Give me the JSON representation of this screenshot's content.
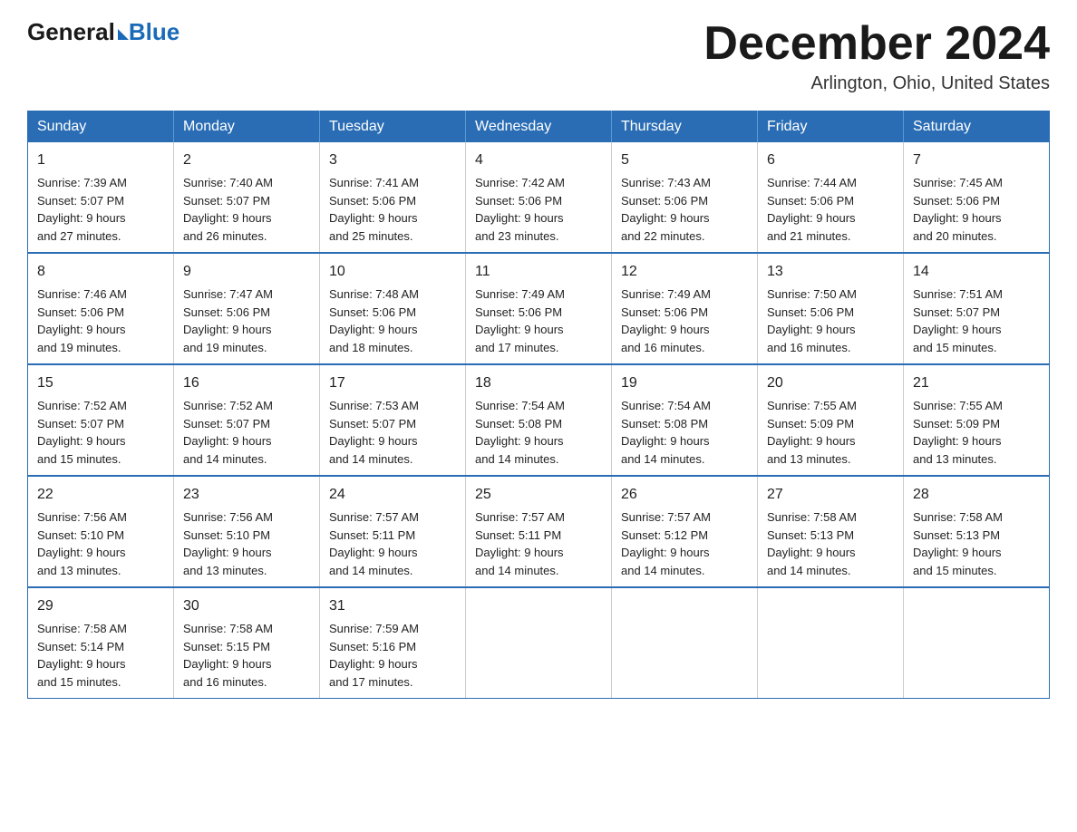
{
  "header": {
    "logo_general": "General",
    "logo_blue": "Blue",
    "month_title": "December 2024",
    "location": "Arlington, Ohio, United States"
  },
  "weekdays": [
    "Sunday",
    "Monday",
    "Tuesday",
    "Wednesday",
    "Thursday",
    "Friday",
    "Saturday"
  ],
  "weeks": [
    [
      {
        "day": "1",
        "sunrise": "7:39 AM",
        "sunset": "5:07 PM",
        "daylight": "9 hours and 27 minutes."
      },
      {
        "day": "2",
        "sunrise": "7:40 AM",
        "sunset": "5:07 PM",
        "daylight": "9 hours and 26 minutes."
      },
      {
        "day": "3",
        "sunrise": "7:41 AM",
        "sunset": "5:06 PM",
        "daylight": "9 hours and 25 minutes."
      },
      {
        "day": "4",
        "sunrise": "7:42 AM",
        "sunset": "5:06 PM",
        "daylight": "9 hours and 23 minutes."
      },
      {
        "day": "5",
        "sunrise": "7:43 AM",
        "sunset": "5:06 PM",
        "daylight": "9 hours and 22 minutes."
      },
      {
        "day": "6",
        "sunrise": "7:44 AM",
        "sunset": "5:06 PM",
        "daylight": "9 hours and 21 minutes."
      },
      {
        "day": "7",
        "sunrise": "7:45 AM",
        "sunset": "5:06 PM",
        "daylight": "9 hours and 20 minutes."
      }
    ],
    [
      {
        "day": "8",
        "sunrise": "7:46 AM",
        "sunset": "5:06 PM",
        "daylight": "9 hours and 19 minutes."
      },
      {
        "day": "9",
        "sunrise": "7:47 AM",
        "sunset": "5:06 PM",
        "daylight": "9 hours and 19 minutes."
      },
      {
        "day": "10",
        "sunrise": "7:48 AM",
        "sunset": "5:06 PM",
        "daylight": "9 hours and 18 minutes."
      },
      {
        "day": "11",
        "sunrise": "7:49 AM",
        "sunset": "5:06 PM",
        "daylight": "9 hours and 17 minutes."
      },
      {
        "day": "12",
        "sunrise": "7:49 AM",
        "sunset": "5:06 PM",
        "daylight": "9 hours and 16 minutes."
      },
      {
        "day": "13",
        "sunrise": "7:50 AM",
        "sunset": "5:06 PM",
        "daylight": "9 hours and 16 minutes."
      },
      {
        "day": "14",
        "sunrise": "7:51 AM",
        "sunset": "5:07 PM",
        "daylight": "9 hours and 15 minutes."
      }
    ],
    [
      {
        "day": "15",
        "sunrise": "7:52 AM",
        "sunset": "5:07 PM",
        "daylight": "9 hours and 15 minutes."
      },
      {
        "day": "16",
        "sunrise": "7:52 AM",
        "sunset": "5:07 PM",
        "daylight": "9 hours and 14 minutes."
      },
      {
        "day": "17",
        "sunrise": "7:53 AM",
        "sunset": "5:07 PM",
        "daylight": "9 hours and 14 minutes."
      },
      {
        "day": "18",
        "sunrise": "7:54 AM",
        "sunset": "5:08 PM",
        "daylight": "9 hours and 14 minutes."
      },
      {
        "day": "19",
        "sunrise": "7:54 AM",
        "sunset": "5:08 PM",
        "daylight": "9 hours and 14 minutes."
      },
      {
        "day": "20",
        "sunrise": "7:55 AM",
        "sunset": "5:09 PM",
        "daylight": "9 hours and 13 minutes."
      },
      {
        "day": "21",
        "sunrise": "7:55 AM",
        "sunset": "5:09 PM",
        "daylight": "9 hours and 13 minutes."
      }
    ],
    [
      {
        "day": "22",
        "sunrise": "7:56 AM",
        "sunset": "5:10 PM",
        "daylight": "9 hours and 13 minutes."
      },
      {
        "day": "23",
        "sunrise": "7:56 AM",
        "sunset": "5:10 PM",
        "daylight": "9 hours and 13 minutes."
      },
      {
        "day": "24",
        "sunrise": "7:57 AM",
        "sunset": "5:11 PM",
        "daylight": "9 hours and 14 minutes."
      },
      {
        "day": "25",
        "sunrise": "7:57 AM",
        "sunset": "5:11 PM",
        "daylight": "9 hours and 14 minutes."
      },
      {
        "day": "26",
        "sunrise": "7:57 AM",
        "sunset": "5:12 PM",
        "daylight": "9 hours and 14 minutes."
      },
      {
        "day": "27",
        "sunrise": "7:58 AM",
        "sunset": "5:13 PM",
        "daylight": "9 hours and 14 minutes."
      },
      {
        "day": "28",
        "sunrise": "7:58 AM",
        "sunset": "5:13 PM",
        "daylight": "9 hours and 15 minutes."
      }
    ],
    [
      {
        "day": "29",
        "sunrise": "7:58 AM",
        "sunset": "5:14 PM",
        "daylight": "9 hours and 15 minutes."
      },
      {
        "day": "30",
        "sunrise": "7:58 AM",
        "sunset": "5:15 PM",
        "daylight": "9 hours and 16 minutes."
      },
      {
        "day": "31",
        "sunrise": "7:59 AM",
        "sunset": "5:16 PM",
        "daylight": "9 hours and 17 minutes."
      },
      null,
      null,
      null,
      null
    ]
  ],
  "labels": {
    "sunrise": "Sunrise:",
    "sunset": "Sunset:",
    "daylight": "Daylight:"
  }
}
